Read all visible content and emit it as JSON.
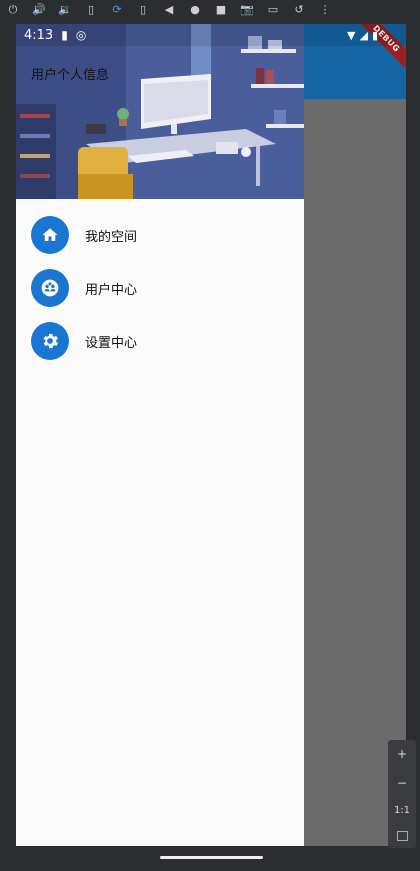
{
  "emulator_toolbar": {
    "icons": [
      "power-icon",
      "volume-up-icon",
      "volume-down-icon",
      "rotate-left-icon",
      "rotate-right-icon",
      "back-icon",
      "home-icon",
      "overview-icon",
      "camera-icon",
      "screen-record-icon",
      "undo-icon",
      "more-icon"
    ]
  },
  "status_bar": {
    "time": "4:13"
  },
  "debug_banner": {
    "label": "DEBUG"
  },
  "drawer": {
    "header_title": "用户个人信息",
    "items": [
      {
        "label": "我的空间",
        "icon": "home-icon"
      },
      {
        "label": "用户中心",
        "icon": "users-icon"
      },
      {
        "label": "设置中心",
        "icon": "settings-icon"
      }
    ]
  },
  "zoom_panel": {
    "plus": "+",
    "minus": "−",
    "one_to_one": "1:1"
  },
  "colors": {
    "accent": "#1976d2",
    "appbar": "#1565a5",
    "drawer_bg": "#fafafa",
    "scrim": "#6b6b6b"
  }
}
